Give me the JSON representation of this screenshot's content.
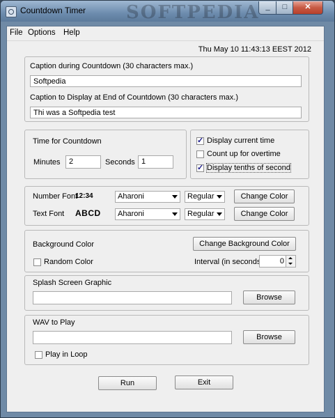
{
  "window": {
    "title": "Countdown Timer",
    "watermark": "SOFTPEDIA",
    "min_glyph": "_",
    "max_glyph": "□",
    "close_glyph": "✕"
  },
  "menu": {
    "file": "File",
    "options": "Options",
    "help": "Help"
  },
  "datetime": "Thu May 10 11:43:13 EEST 2012",
  "caption_panel": {
    "during_label": "Caption during Countdown (30 characters max.)",
    "during_value": "Softpedia",
    "end_label": "Caption to Display at End of Countdown (30 characters max.)",
    "end_value": "Thi was a Softpedia test"
  },
  "time_panel": {
    "title": "Time for Countdown",
    "minutes_label": "Minutes",
    "minutes_value": "2",
    "seconds_label": "Seconds",
    "seconds_value": "1"
  },
  "display_options": [
    {
      "label": "Display current time",
      "checked": true
    },
    {
      "label": "Count up for overtime",
      "checked": false
    },
    {
      "label": "Display tenths of second",
      "checked": true
    }
  ],
  "font_panel": {
    "number_font_label": "Number Font",
    "number_sample": "12:34",
    "number_font": "Aharoni",
    "number_style": "Regular",
    "text_font_label": "Text Font",
    "text_sample": "ABCD",
    "text_font": "Aharoni",
    "text_style": "Regular",
    "change_color": "Change Color"
  },
  "background_panel": {
    "label": "Background Color",
    "change_button": "Change Background Color",
    "random_label": "Random Color",
    "random_checked": false,
    "interval_label": "Interval (in seconds)",
    "interval_value": "0"
  },
  "splash_panel": {
    "title": "Splash Screen Graphic",
    "path": "",
    "browse": "Browse"
  },
  "wav_panel": {
    "title": "WAV to Play",
    "path": "",
    "browse": "Browse",
    "loop_label": "Play in Loop",
    "loop_checked": false
  },
  "actions": {
    "run": "Run",
    "exit": "Exit"
  }
}
